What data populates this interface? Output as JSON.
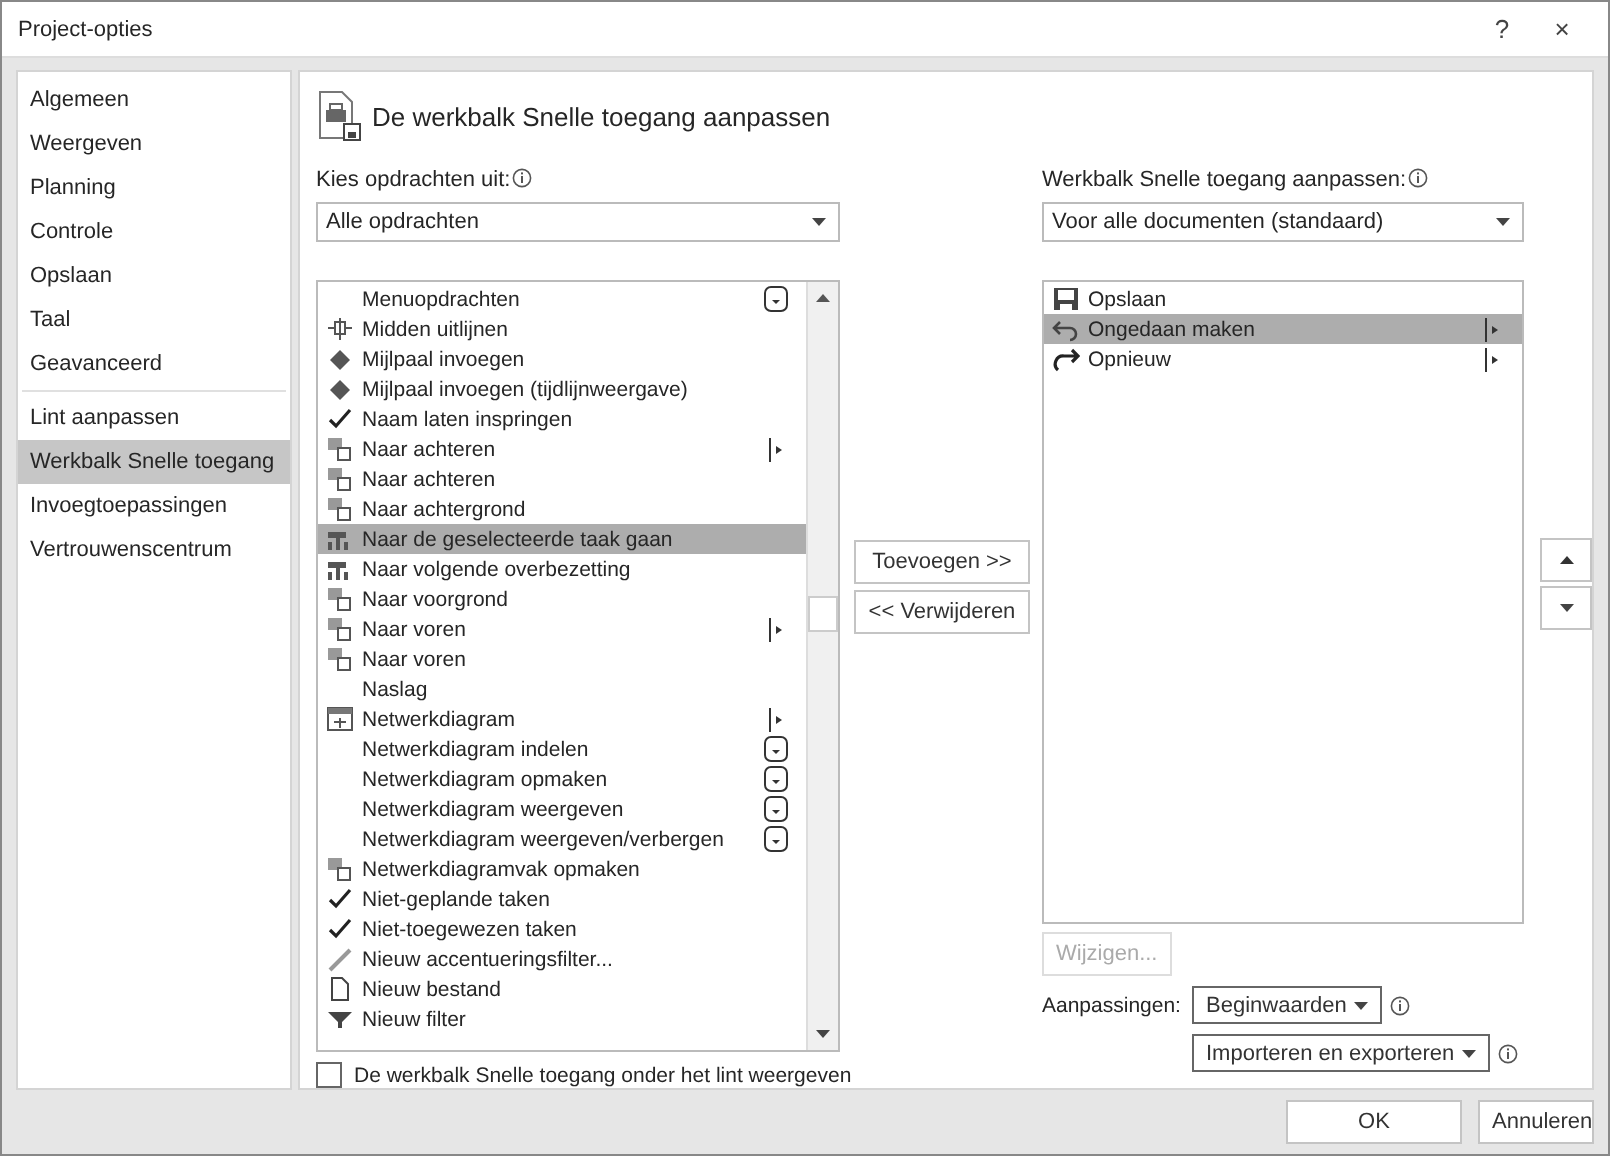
{
  "window": {
    "title": "Project-opties",
    "help": "?",
    "close": "×"
  },
  "sidebar": {
    "groups": [
      [
        {
          "label": "Algemeen",
          "selected": false
        },
        {
          "label": "Weergeven",
          "selected": false
        },
        {
          "label": "Planning",
          "selected": false
        },
        {
          "label": "Controle",
          "selected": false
        },
        {
          "label": "Opslaan",
          "selected": false
        },
        {
          "label": "Taal",
          "selected": false
        },
        {
          "label": "Geavanceerd",
          "selected": false
        }
      ],
      [
        {
          "label": "Lint aanpassen",
          "selected": false
        },
        {
          "label": "Werkbalk Snelle toegang",
          "selected": true
        },
        {
          "label": "Invoegtoepassingen",
          "selected": false
        },
        {
          "label": "Vertrouwenscentrum",
          "selected": false
        }
      ]
    ]
  },
  "header": {
    "title": "De werkbalk Snelle toegang aanpassen"
  },
  "commands": {
    "label": "Kies opdrachten uit:",
    "dropdown": "Alle opdrachten",
    "items": [
      {
        "label": "Menuopdrachten",
        "kind": "none",
        "has_submenu": false,
        "has_dropdown": true,
        "selected": false
      },
      {
        "label": "Midden uitlijnen",
        "kind": "align",
        "has_submenu": false,
        "has_dropdown": false,
        "selected": false
      },
      {
        "label": "Mijlpaal invoegen",
        "kind": "diamond",
        "has_submenu": false,
        "has_dropdown": false,
        "selected": false
      },
      {
        "label": "Mijlpaal invoegen (tijdlijnweergave)",
        "kind": "diamond",
        "has_submenu": false,
        "has_dropdown": false,
        "selected": false
      },
      {
        "label": "Naam laten inspringen",
        "kind": "check",
        "has_submenu": false,
        "has_dropdown": false,
        "selected": false
      },
      {
        "label": "Naar achteren",
        "kind": "shape",
        "has_submenu": true,
        "has_dropdown": false,
        "selected": false
      },
      {
        "label": "Naar achteren",
        "kind": "shape",
        "has_submenu": false,
        "has_dropdown": false,
        "selected": false
      },
      {
        "label": "Naar achtergrond",
        "kind": "shape",
        "has_submenu": false,
        "has_dropdown": false,
        "selected": false
      },
      {
        "label": "Naar de geselecteerde taak gaan",
        "kind": "bars",
        "has_submenu": false,
        "has_dropdown": false,
        "selected": true
      },
      {
        "label": "Naar volgende overbezetting",
        "kind": "bars",
        "has_submenu": false,
        "has_dropdown": false,
        "selected": false
      },
      {
        "label": "Naar voorgrond",
        "kind": "shape",
        "has_submenu": false,
        "has_dropdown": false,
        "selected": false
      },
      {
        "label": "Naar voren",
        "kind": "shape",
        "has_submenu": true,
        "has_dropdown": false,
        "selected": false
      },
      {
        "label": "Naar voren",
        "kind": "shape",
        "has_submenu": false,
        "has_dropdown": false,
        "selected": false
      },
      {
        "label": "Naslag",
        "kind": "none",
        "has_submenu": false,
        "has_dropdown": false,
        "selected": false
      },
      {
        "label": "Netwerkdiagram",
        "kind": "grid",
        "has_submenu": true,
        "has_dropdown": false,
        "selected": false
      },
      {
        "label": "Netwerkdiagram indelen",
        "kind": "none",
        "has_submenu": false,
        "has_dropdown": true,
        "selected": false
      },
      {
        "label": "Netwerkdiagram opmaken",
        "kind": "none",
        "has_submenu": false,
        "has_dropdown": true,
        "selected": false
      },
      {
        "label": "Netwerkdiagram weergeven",
        "kind": "none",
        "has_submenu": false,
        "has_dropdown": true,
        "selected": false
      },
      {
        "label": "Netwerkdiagram weergeven/verbergen",
        "kind": "none",
        "has_submenu": false,
        "has_dropdown": true,
        "selected": false
      },
      {
        "label": "Netwerkdiagramvak opmaken",
        "kind": "shape",
        "has_submenu": false,
        "has_dropdown": false,
        "selected": false
      },
      {
        "label": "Niet-geplande taken",
        "kind": "check",
        "has_submenu": false,
        "has_dropdown": false,
        "selected": false
      },
      {
        "label": "Niet-toegewezen taken",
        "kind": "check",
        "has_submenu": false,
        "has_dropdown": false,
        "selected": false
      },
      {
        "label": "Nieuw accentueringsfilter...",
        "kind": "pen",
        "has_submenu": false,
        "has_dropdown": false,
        "selected": false
      },
      {
        "label": "Nieuw bestand",
        "kind": "document",
        "has_submenu": false,
        "has_dropdown": false,
        "selected": false
      },
      {
        "label": "Nieuw filter",
        "kind": "filter",
        "has_submenu": false,
        "has_dropdown": false,
        "selected": false
      }
    ]
  },
  "toolbar": {
    "label": "Werkbalk Snelle toegang aanpassen:",
    "dropdown": "Voor alle documenten (standaard)",
    "items": [
      {
        "label": "Opslaan",
        "kind": "save",
        "has_submenu": false,
        "has_dropdown": false,
        "selected": false
      },
      {
        "label": "Ongedaan maken",
        "kind": "undo",
        "has_submenu": true,
        "has_dropdown": false,
        "selected": true
      },
      {
        "label": "Opnieuw",
        "kind": "redo",
        "has_submenu": true,
        "has_dropdown": false,
        "selected": false
      }
    ]
  },
  "add_button": {
    "label": "Toevoegen >>",
    "disabled": false
  },
  "remove_button": {
    "label": "<< Verwijderen",
    "disabled": false
  },
  "modify_button": {
    "label": "Wijzigen...",
    "disabled": true
  },
  "customizations": {
    "label": "Aanpassingen:",
    "reset": "Beginwaarden",
    "import_export": "Importeren en exporteren"
  },
  "checkbox": {
    "label": "De werkbalk Snelle toegang onder het lint weergeven",
    "checked": false
  },
  "footer": {
    "ok": "OK",
    "cancel": "Annuleren"
  }
}
